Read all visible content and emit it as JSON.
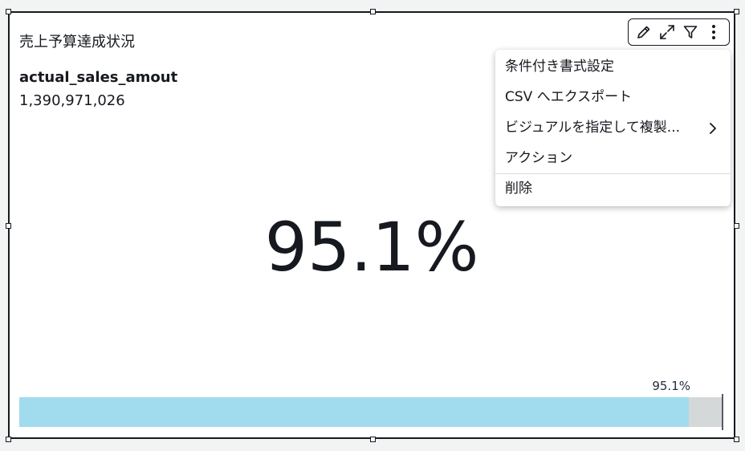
{
  "visual": {
    "title": "売上予算達成状況",
    "metric_label": "actual_sales_amout",
    "metric_value": "1,390,971,026",
    "percent_display": "95.1%",
    "progress": {
      "label": "95.1%",
      "fraction": 0.951,
      "fill_color": "#a0dcee",
      "track_color": "#d5d8d8"
    }
  },
  "toolbar": {
    "icons": [
      "pencil-icon",
      "expand-icon",
      "filter-icon",
      "more-vertical-icon"
    ]
  },
  "menu": {
    "items": [
      {
        "label": "条件付き書式設定"
      },
      {
        "label": "CSV へエクスポート"
      },
      {
        "label": "ビジュアルを指定して複製..."
      },
      {
        "label": "アクション"
      },
      {
        "label": "削除"
      }
    ]
  }
}
